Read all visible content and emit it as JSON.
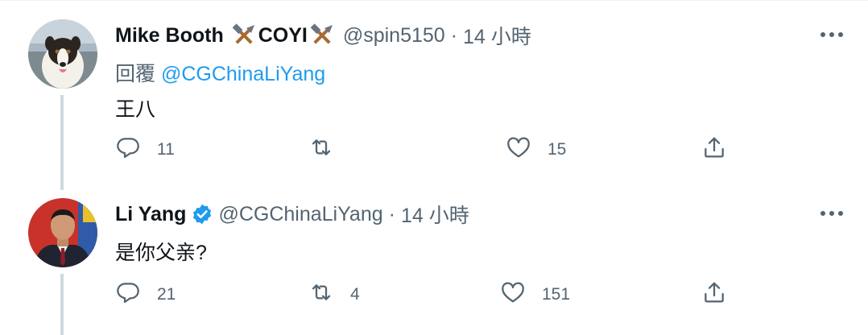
{
  "tweets": [
    {
      "author_name": "Mike Booth",
      "name_suffix": "COYI",
      "handle": "@spin5150",
      "separator": "·",
      "time": "14 小時",
      "reply_prefix": "回覆",
      "reply_mention": "@CGChinaLiYang",
      "text": "王八",
      "replies": "11",
      "retweets": "",
      "likes": "15",
      "icons": [
        "hammer-pick-icon",
        "comment-icon",
        "retweet-icon",
        "heart-icon",
        "share-icon",
        "more-icon"
      ]
    },
    {
      "author_name": "Li Yang",
      "verified": true,
      "handle": "@CGChinaLiYang",
      "separator": "·",
      "time": "14 小時",
      "text": "是你父亲?",
      "replies": "21",
      "retweets": "4",
      "likes": "151",
      "icons": [
        "verified-badge-icon",
        "comment-icon",
        "retweet-icon",
        "heart-icon",
        "share-icon",
        "more-icon"
      ]
    }
  ],
  "colors": {
    "text": "#0f1419",
    "secondary": "#536471",
    "link": "#1d9bf0",
    "verified": "#1d9bf0",
    "thread_line": "#cfd9de"
  }
}
